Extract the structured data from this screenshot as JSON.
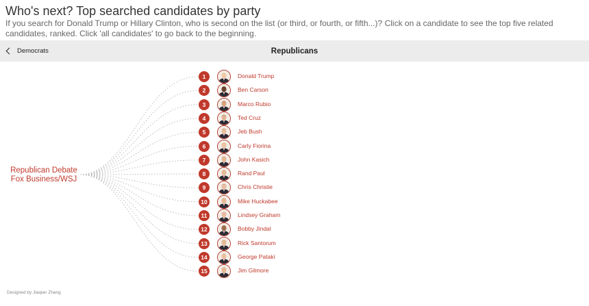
{
  "header": {
    "title": "Who's next? Top searched candidates by party",
    "subtitle": "If you search for Donald Trump or Hillary Clinton, who is second on the list (or third, or fourth, or fifth...)? Click on a candidate to see the top five related candidates, ranked. Click 'all candidates' to go back to the beginning."
  },
  "nav": {
    "back_label": "Democrats",
    "party_title": "Republicans"
  },
  "event": {
    "line1": "Republican Debate",
    "line2": "Fox Business/WSJ"
  },
  "candidates": [
    {
      "rank": "1",
      "name": "Donald Trump",
      "hair": "#e0c27a",
      "skin": "#f2c9a6"
    },
    {
      "rank": "2",
      "name": "Ben Carson",
      "hair": "#222222",
      "skin": "#6b4430"
    },
    {
      "rank": "3",
      "name": "Marco Rubio",
      "hair": "#2b2019",
      "skin": "#d7a27e"
    },
    {
      "rank": "4",
      "name": "Ted Cruz",
      "hair": "#2b2019",
      "skin": "#e2b592"
    },
    {
      "rank": "5",
      "name": "Jeb Bush",
      "hair": "#6f5b4b",
      "skin": "#e7bea0"
    },
    {
      "rank": "6",
      "name": "Carly Fiorina",
      "hair": "#a7753f",
      "skin": "#eec4a5"
    },
    {
      "rank": "7",
      "name": "John Kasich",
      "hair": "#6a6a6a",
      "skin": "#e6b996"
    },
    {
      "rank": "8",
      "name": "Rand Paul",
      "hair": "#5b4533",
      "skin": "#e6bb98"
    },
    {
      "rank": "9",
      "name": "Chris Christie",
      "hair": "#3a2e28",
      "skin": "#e9bda0"
    },
    {
      "rank": "10",
      "name": "Mike Huckabee",
      "hair": "#8a8a8a",
      "skin": "#e6b996"
    },
    {
      "rank": "11",
      "name": "Lindsey Graham",
      "hair": "#9a9a9a",
      "skin": "#e8bea0"
    },
    {
      "rank": "12",
      "name": "Bobby Jindal",
      "hair": "#1e1a18",
      "skin": "#a06f50"
    },
    {
      "rank": "13",
      "name": "Rick Santorum",
      "hair": "#5a4636",
      "skin": "#e6bb98"
    },
    {
      "rank": "14",
      "name": "George Pataki",
      "hair": "#b8b8b8",
      "skin": "#e9c0a2"
    },
    {
      "rank": "15",
      "name": "Jim Gilmore",
      "hair": "#8c8c8c",
      "skin": "#e6b996"
    }
  ],
  "footer": {
    "credit": "Designed by Jiaqian Zhang"
  },
  "colors": {
    "accent": "#c0392b",
    "navbar_bg": "#ececec",
    "connector": "#bbbbbb"
  },
  "icons": {
    "back": "chevron-left-icon",
    "portrait": "portrait-icon"
  }
}
